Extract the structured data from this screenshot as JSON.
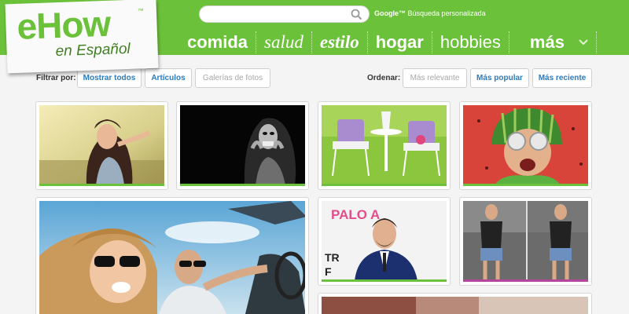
{
  "brand": {
    "logo_text": "eHow",
    "logo_tm": "™",
    "logo_sub": "en Español",
    "green": "#6cc13a",
    "link_blue": "#2a7bbf",
    "accent_purple": "#b5469b"
  },
  "search": {
    "value": "",
    "placeholder": "",
    "powered_by": "Google™",
    "powered_label": "Búsqueda personalizada"
  },
  "nav": {
    "items": [
      "comida",
      "salud",
      "estilo",
      "hogar",
      "hobbies",
      "más"
    ],
    "more_icon": "chevron-down-icon"
  },
  "filter": {
    "label": "Filtrar por:",
    "options": [
      "Mostrar todos",
      "Artículos",
      "Galerías de fotos"
    ]
  },
  "sort": {
    "label": "Ordenar:",
    "options": [
      "Más relevante",
      "Más popular",
      "Más reciente"
    ]
  },
  "cards": [
    {
      "subject": "woman-field",
      "bar_color": "#6cc13a"
    },
    {
      "subject": "dark-portrait",
      "bar_color": "#6cc13a"
    },
    {
      "subject": "garden-chairs",
      "bar_color": "#6cc13a"
    },
    {
      "subject": "watermelon-helmet",
      "bar_color": "#6cc13a"
    },
    {
      "subject": "convertible-couple",
      "bar_color": "#6cc13a"
    },
    {
      "subject": "red-carpet-man",
      "bar_color": "#6cc13a",
      "sign_text": "PALO A",
      "sign_text_2": "TR",
      "sign_text_3": "F"
    },
    {
      "subject": "street-couple",
      "bar_color": "#b5469b"
    },
    {
      "subject": "partial-bottom",
      "bar_color": "#6cc13a"
    }
  ]
}
